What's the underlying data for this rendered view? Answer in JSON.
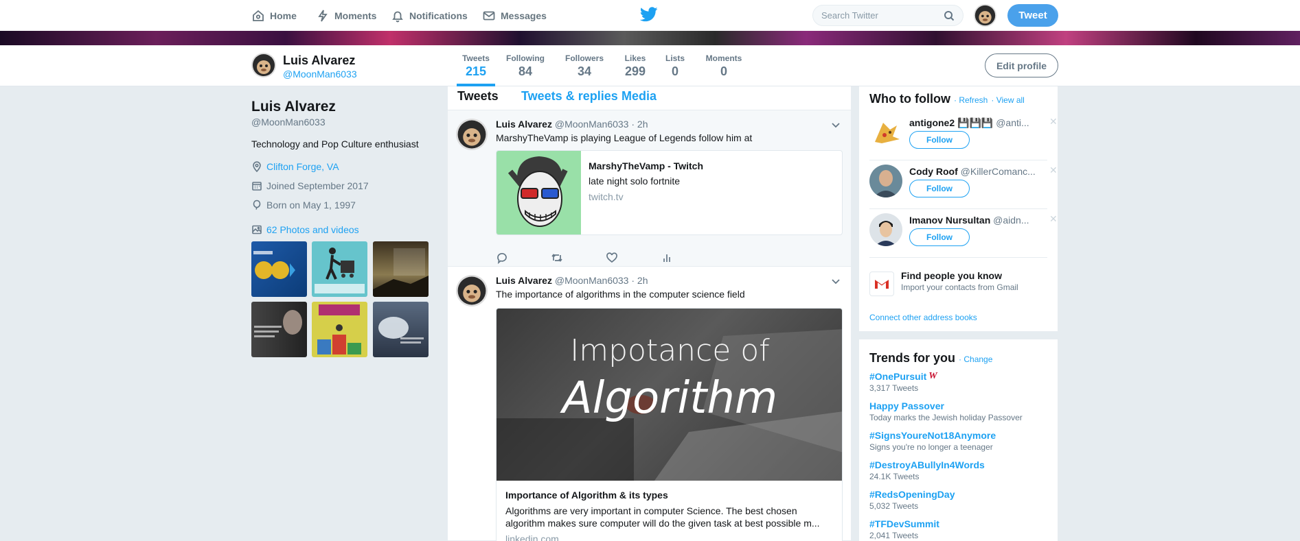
{
  "nav": {
    "home": "Home",
    "moments": "Moments",
    "notifications": "Notifications",
    "messages": "Messages",
    "search_placeholder": "Search Twitter",
    "tweet_button": "Tweet"
  },
  "profile_nav": {
    "name": "Luis Alvarez",
    "handle": "@MoonMan6033",
    "stats": [
      {
        "label": "Tweets",
        "value": "215"
      },
      {
        "label": "Following",
        "value": "84"
      },
      {
        "label": "Followers",
        "value": "34"
      },
      {
        "label": "Likes",
        "value": "299"
      },
      {
        "label": "Lists",
        "value": "0"
      },
      {
        "label": "Moments",
        "value": "0"
      }
    ],
    "edit_profile": "Edit profile"
  },
  "sidebar": {
    "name": "Luis Alvarez",
    "handle": "@MoonMan6033",
    "bio": "Technology and Pop Culture enthusiast",
    "location": "Clifton Forge, VA",
    "joined": "Joined September 2017",
    "born": "Born on May 1, 1997",
    "media_link": "62 Photos and videos"
  },
  "timeline": {
    "tabs": [
      "Tweets",
      "Tweets & replies",
      "Media"
    ],
    "tweets": [
      {
        "name": "Luis Alvarez",
        "handle": "@MoonMan6033",
        "time": "· 2h",
        "text": "MarshyTheVamp is playing League of Legends follow him at",
        "card_title": "MarshyTheVamp - Twitch",
        "card_desc": "late night solo fortnite",
        "card_url": "twitch.tv"
      },
      {
        "name": "Luis Alvarez",
        "handle": "@MoonMan6033",
        "time": "· 2h",
        "text": "The importance of algorithms in the computer science field",
        "image_line1": "Impotance of",
        "image_line2": "Algorithm",
        "card_title": "Importance of Algorithm & its types",
        "card_desc": "Algorithms are very important in computer Science. The best chosen algorithm makes sure computer will do the given task at best possible m...",
        "card_url": "linkedin.com"
      }
    ]
  },
  "who_to_follow": {
    "title": "Who to follow",
    "refresh": "· Refresh",
    "view_all": "· View all",
    "users": [
      {
        "name": "antigone2 💾💾💾",
        "handle": "@anti...",
        "button": "Follow"
      },
      {
        "name": "Cody Roof",
        "handle": "@KillerComanc...",
        "button": "Follow"
      },
      {
        "name": "Imanov Nursultan",
        "handle": "@aidn...",
        "button": "Follow"
      }
    ],
    "find_title": "Find people you know",
    "find_sub": "Import your contacts from Gmail",
    "connect": "Connect other address books"
  },
  "trends": {
    "title": "Trends for you",
    "change": "· Change",
    "items": [
      {
        "name": "#OnePursuit",
        "sub": "3,317 Tweets"
      },
      {
        "name": "Happy Passover",
        "sub": "Today marks the Jewish holiday Passover"
      },
      {
        "name": "#SignsYoureNot18Anymore",
        "sub": "Signs you're no longer a teenager"
      },
      {
        "name": "#DestroyABullyIn4Words",
        "sub": "24.1K Tweets"
      },
      {
        "name": "#RedsOpeningDay",
        "sub": "5,032 Tweets"
      },
      {
        "name": "#TFDevSummit",
        "sub": "2,041 Tweets"
      }
    ]
  },
  "colors": {
    "accent": "#1da1f2",
    "background": "#e6ecf0",
    "muted": "#657786"
  }
}
